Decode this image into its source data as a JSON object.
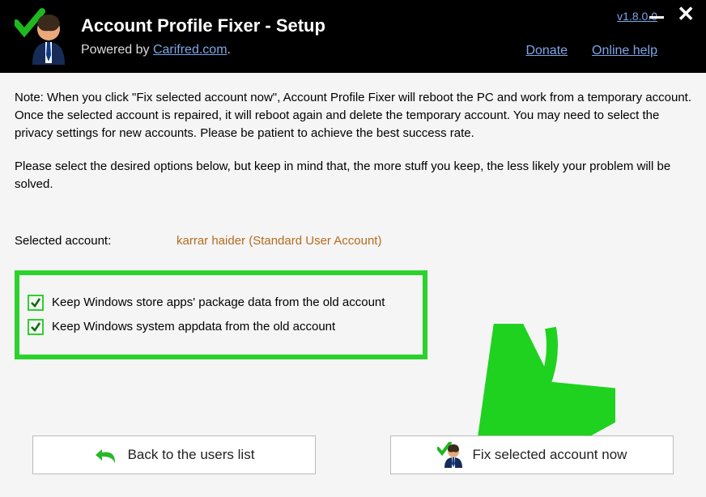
{
  "header": {
    "title": "Account Profile Fixer - Setup",
    "powered_prefix": "Powered by ",
    "powered_link": "Carifred.com",
    "powered_suffix": ".",
    "version": "v1.8.0.0",
    "donate": "Donate",
    "online_help": "Online help"
  },
  "note": {
    "p1": "Note: When you click \"Fix selected account now\", Account Profile Fixer will reboot the PC and work from a temporary account. Once the selected account is repaired, it will reboot again and delete the temporary account. You may need to select the privacy settings for new accounts. Please be patient to achieve the best success rate.",
    "p2": "Please select the desired options below, but keep in mind that, the more stuff you keep, the less likely your problem will be solved."
  },
  "selected": {
    "label": "Selected account:",
    "value": "karrar haider (Standard User Account)"
  },
  "options": {
    "opt1": "Keep Windows store apps' package data from the old account",
    "opt2": "Keep Windows system appdata from the old account"
  },
  "buttons": {
    "back": "Back to the users list",
    "fix": "Fix selected account now"
  }
}
